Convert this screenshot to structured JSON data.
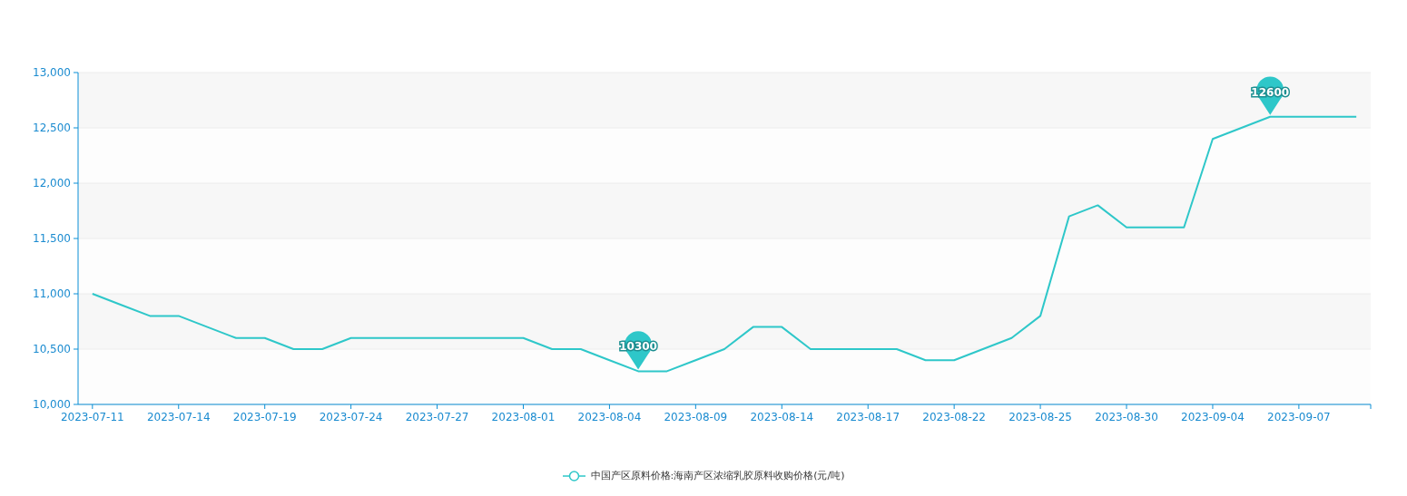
{
  "chart": {
    "chart_data": {
      "type": "line",
      "categories": [
        "2023-07-11",
        null,
        null,
        "2023-07-14",
        null,
        null,
        "2023-07-19",
        null,
        null,
        "2023-07-24",
        null,
        null,
        "2023-07-27",
        null,
        null,
        "2023-08-01",
        null,
        null,
        "2023-08-04",
        null,
        null,
        "2023-08-09",
        null,
        null,
        "2023-08-14",
        null,
        null,
        "2023-08-17",
        null,
        null,
        "2023-08-22",
        null,
        null,
        "2023-08-25",
        null,
        null,
        "2023-08-30",
        null,
        null,
        "2023-09-04",
        null,
        null,
        "2023-09-07",
        null,
        null
      ],
      "series": [
        {
          "name": "中国产区原料价格:海南产区浓缩乳胶原料收购价格(元/吨)",
          "color": "#2ec7c9",
          "values": [
            11000,
            10900,
            10800,
            10800,
            10700,
            10600,
            10600,
            10500,
            10500,
            10600,
            10600,
            10600,
            10600,
            10600,
            10600,
            10600,
            10500,
            10500,
            10400,
            10300,
            10300,
            10400,
            10500,
            10700,
            10700,
            10500,
            10500,
            10500,
            10500,
            10400,
            10400,
            10500,
            10600,
            10800,
            11700,
            11800,
            11600,
            11600,
            11600,
            12400,
            12500,
            12600,
            12600,
            12600,
            12600
          ]
        }
      ],
      "ylim": [
        10000,
        13000
      ],
      "yticks": [
        {
          "value": 10000,
          "label": "10,000"
        },
        {
          "value": 10500,
          "label": "10,500"
        },
        {
          "value": 11000,
          "label": "11,000"
        },
        {
          "value": 11500,
          "label": "11,500"
        },
        {
          "value": 12000,
          "label": "12,000"
        },
        {
          "value": 12500,
          "label": "12,500"
        },
        {
          "value": 13000,
          "label": "13,000"
        }
      ],
      "grid": true,
      "annotations": [
        {
          "y": 12600,
          "text": "12600"
        },
        {
          "y": 10300,
          "text": "10300"
        }
      ]
    }
  }
}
